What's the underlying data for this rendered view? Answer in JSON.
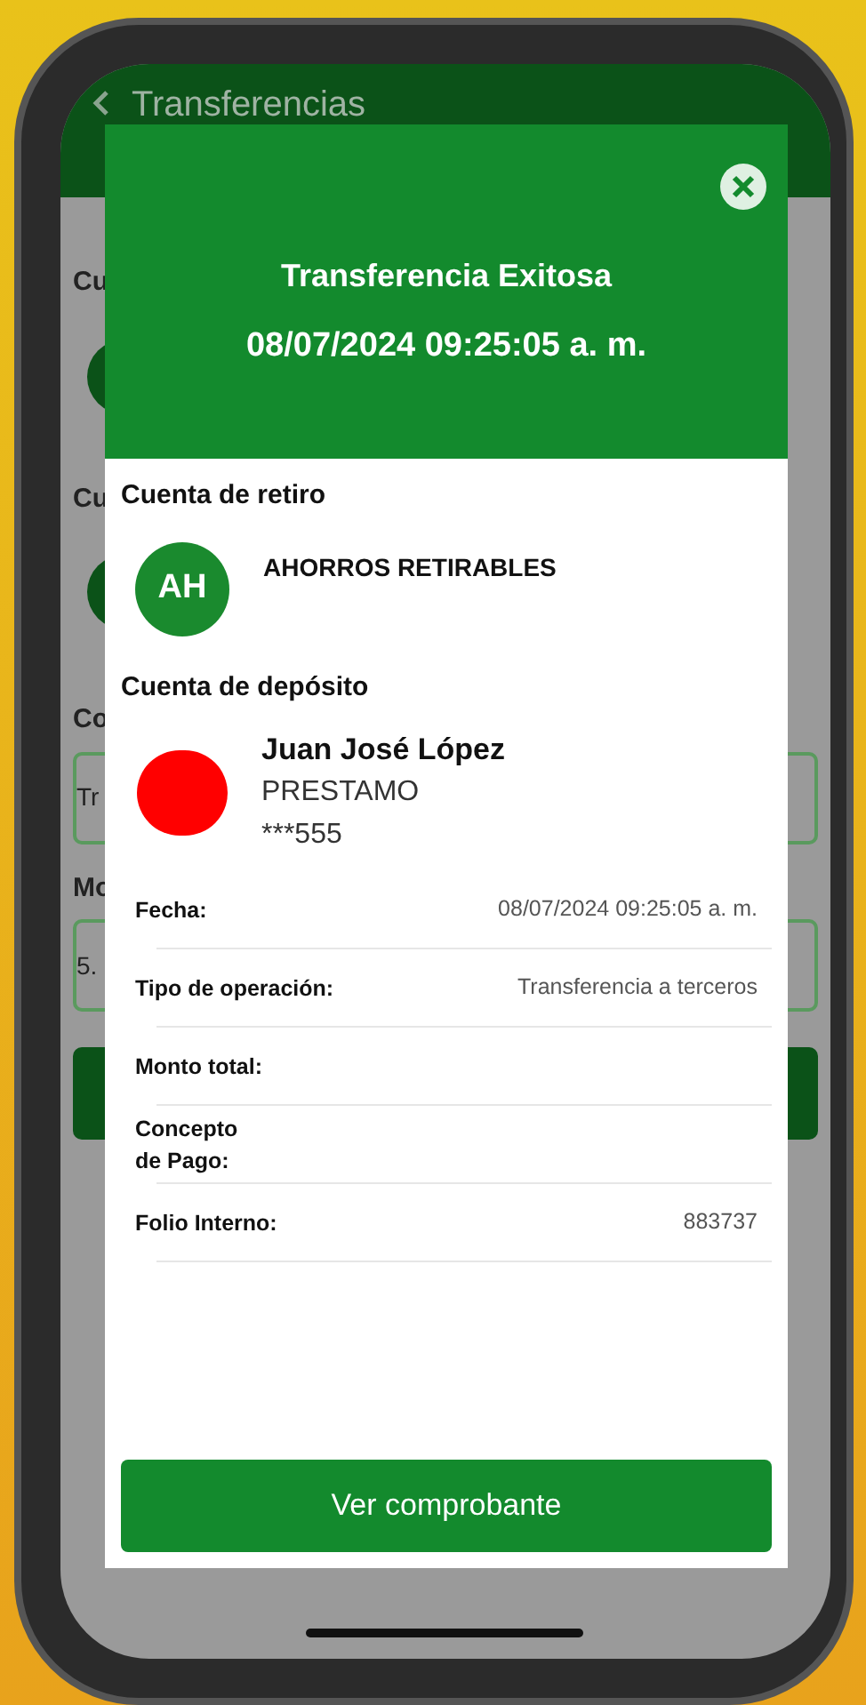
{
  "background_screen": {
    "title": "Transferencias",
    "labels": [
      "Cu",
      "Cu",
      "Co",
      "Mo"
    ],
    "fields": [
      "Tr",
      "5."
    ]
  },
  "modal": {
    "title": "Transferencia Exitosa",
    "datetime": "08/07/2024 09:25:05 a. m.",
    "withdrawal": {
      "heading": "Cuenta de retiro",
      "initials": "AH",
      "name": "AHORROS RETIRABLES"
    },
    "deposit": {
      "heading": "Cuenta de depósito",
      "name": "Juan José López",
      "type": "PRESTAMO",
      "number": "***555"
    },
    "details": [
      {
        "label": "Fecha:",
        "value": "08/07/2024 09:25:05 a. m."
      },
      {
        "label": "Tipo de operación:",
        "value": "Transferencia a terceros"
      },
      {
        "label": "Monto total:"
      },
      {
        "label": "Concepto\nde Pago:"
      },
      {
        "label": "Folio Interno:",
        "value": "883737"
      }
    ],
    "button": "Ver comprobante"
  }
}
